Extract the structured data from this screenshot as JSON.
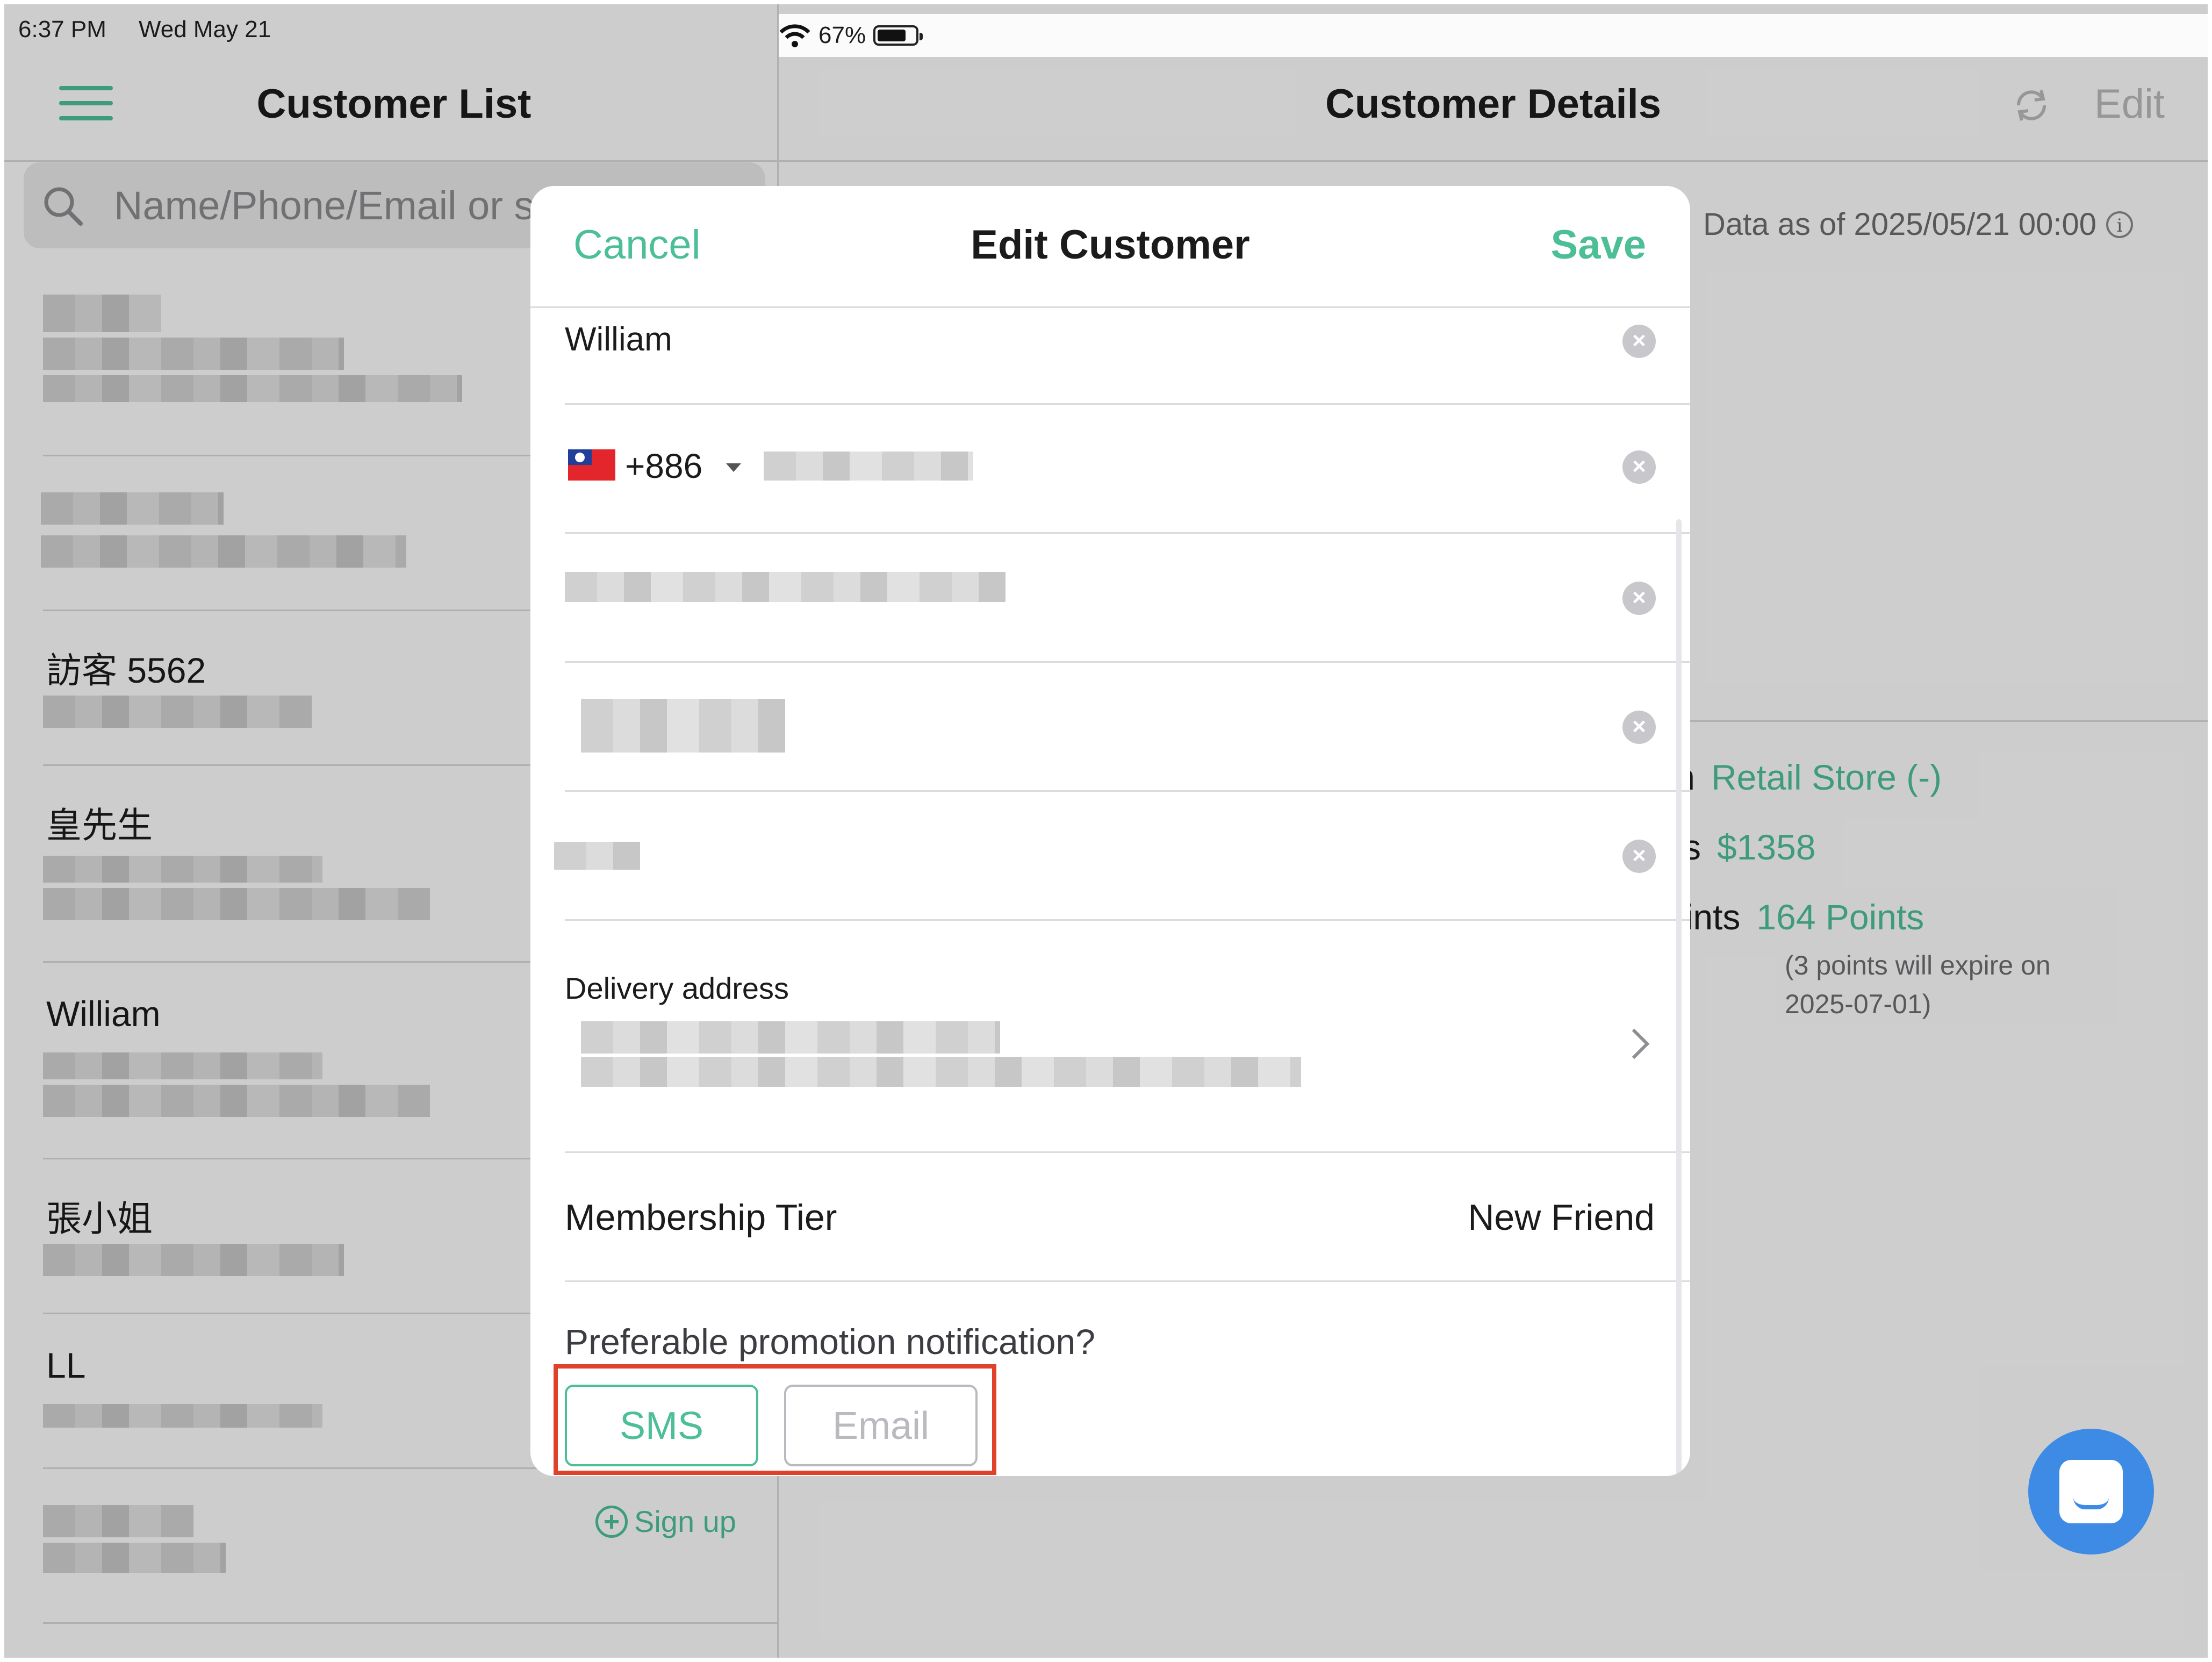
{
  "status_bar": {
    "time": "6:37 PM",
    "date": "Wed May 21",
    "battery": "67%"
  },
  "left_pane": {
    "title": "Customer List",
    "search_placeholder": "Name/Phone/Email or sc",
    "customers": [
      {
        "name": ""
      },
      {
        "name": ""
      },
      {
        "name": "訪客 5562"
      },
      {
        "name": "皇先生"
      },
      {
        "name": "William"
      },
      {
        "name": "張小姐"
      },
      {
        "name": "LL"
      },
      {
        "name": ""
      }
    ],
    "signup_label": "Sign up"
  },
  "right_pane": {
    "title": "Customer Details",
    "edit_label": "Edit",
    "data_as_of": "Data as of 2025/05/21 00:00",
    "store_label": "m",
    "store_value": "Retail Store (-)",
    "credits_label": "its",
    "credits_value": "$1358",
    "points_label": "oints",
    "points_value": "164 Points",
    "points_note_1": "(3 points will expire on",
    "points_note_2": "2025-07-01)"
  },
  "modal": {
    "cancel_label": "Cancel",
    "title": "Edit Customer",
    "save_label": "Save",
    "name_value": "William",
    "country_code": "+886",
    "delivery_label": "Delivery address",
    "tier_label": "Membership Tier",
    "tier_value": "New Friend",
    "promo_question": "Preferable promotion notification?",
    "sms_label": "SMS",
    "email_label": "Email"
  },
  "colors": {
    "accent": "#4cbf96",
    "highlight": "#e0412b",
    "chat": "#3e8be6"
  },
  "icons": {
    "menu": "hamburger-icon",
    "search": "search-icon",
    "refresh": "refresh-icon",
    "info": "info-icon",
    "clear": "clear-icon",
    "chevron": "chevron-right-icon",
    "chat": "chat-icon",
    "flag": "taiwan-flag-icon"
  }
}
